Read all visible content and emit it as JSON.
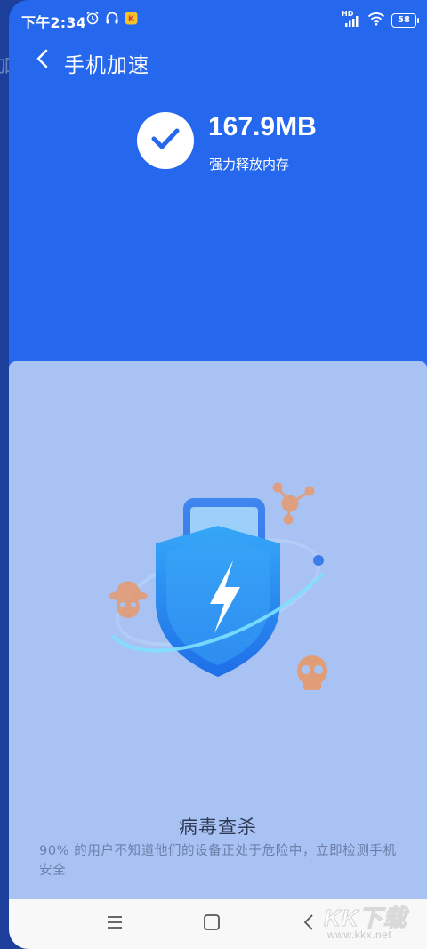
{
  "background_app": {
    "peek_text": "加"
  },
  "status_bar": {
    "time": "下午2:34",
    "left_icons": [
      "alarm-icon",
      "headphones-icon",
      "app-notification-icon"
    ],
    "hd_label": "HD",
    "right_icons": [
      "signal-icon",
      "wifi-icon",
      "battery-icon"
    ],
    "battery_level": "58"
  },
  "header": {
    "back_icon": "chevron-left-icon",
    "title": "手机加速"
  },
  "result": {
    "icon": "check-icon",
    "amount": "167.9MB",
    "caption": "强力释放内存"
  },
  "promo_card": {
    "illustration": "virus-shield-illustration",
    "title": "病毒查杀",
    "description": "90% 的用户不知道他们的设备正处于危险中，立即检测手机安全"
  },
  "nav_bar": {
    "items": [
      "menu-icon",
      "home-icon",
      "back-icon"
    ]
  },
  "watermark": {
    "main": "KK下载",
    "url": "www.kkx.net"
  },
  "colors": {
    "primary_blue": "#2568ee",
    "card_background": "#a9c2f4",
    "shield_blue": "#2d8cf0",
    "virus_orange": "#e79a6b"
  }
}
